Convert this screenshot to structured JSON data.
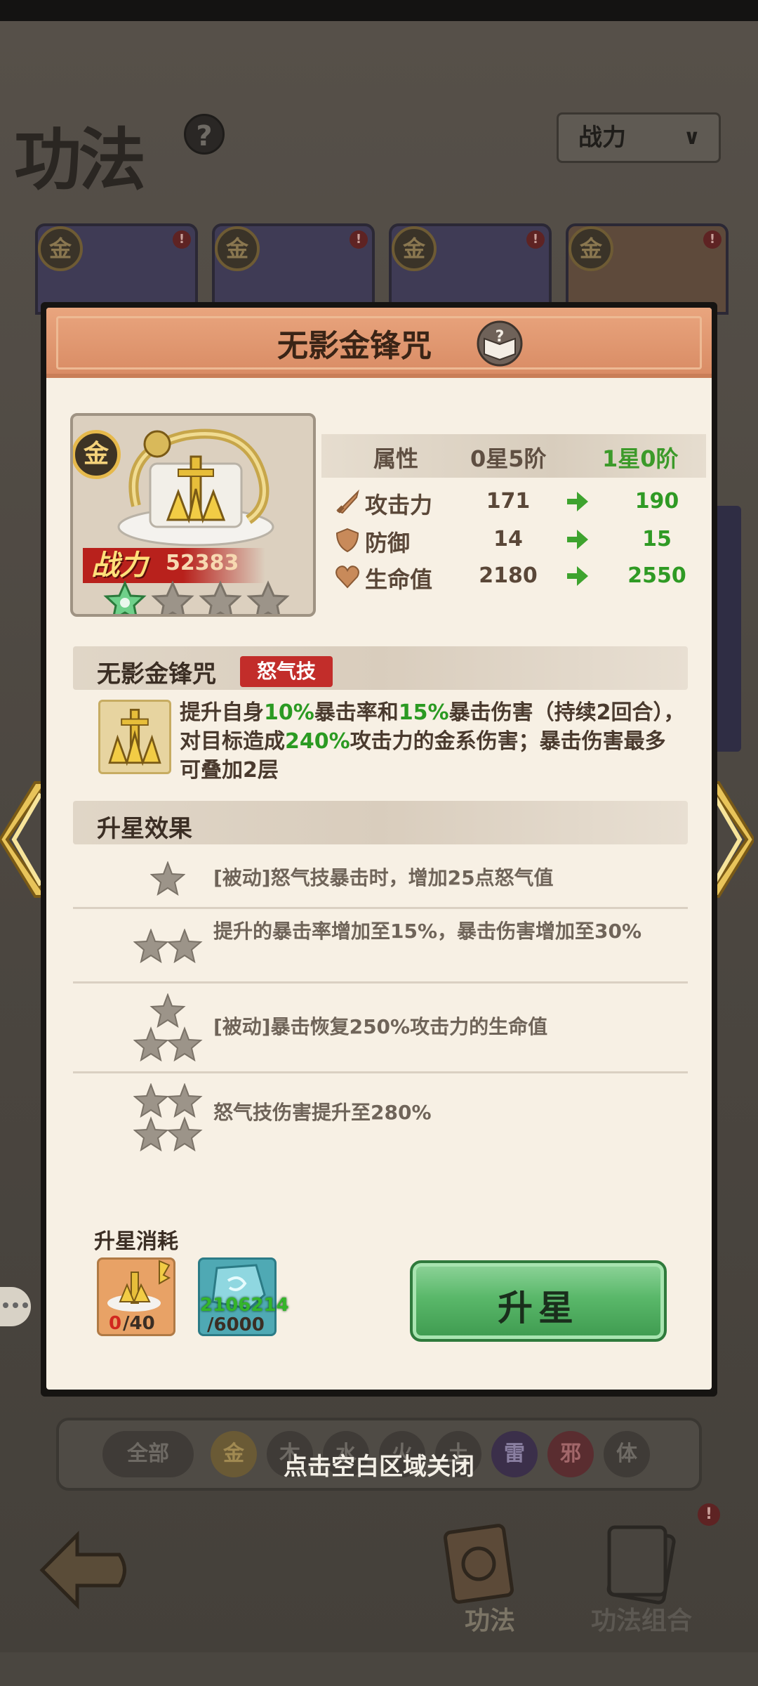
{
  "background": {
    "title": "功法",
    "help_symbol": "?",
    "sort_dropdown": {
      "selected": "战力"
    },
    "card_grade": "金",
    "card_alert": "!",
    "filters": [
      "全部",
      "金",
      "木",
      "水",
      "火",
      "土",
      "雷",
      "邪",
      "体"
    ],
    "bottom_tabs": [
      {
        "label": "功法",
        "active": true
      },
      {
        "label": "功法组合",
        "active": false
      }
    ],
    "tab_alert": "!"
  },
  "close_hint": "点击空白区域关闭",
  "modal": {
    "title": "无影金锋咒",
    "item": {
      "grade": "金",
      "power_label": "战力",
      "power_value": "52383",
      "stars_filled": 1,
      "stars_total": 4
    },
    "attributes": {
      "header": {
        "label": "属性",
        "current": "0星5阶",
        "next": "1星0阶"
      },
      "rows": [
        {
          "name": "攻击力",
          "icon": "sword-icon",
          "current": "171",
          "next": "190"
        },
        {
          "name": "防御",
          "icon": "shield-icon",
          "current": "14",
          "next": "15"
        },
        {
          "name": "生命值",
          "icon": "heart-icon",
          "current": "2180",
          "next": "2550"
        }
      ]
    },
    "skill": {
      "name": "无影金锋咒",
      "tag": "怒气技",
      "desc_parts": [
        {
          "text": "提升自身",
          "hl": false
        },
        {
          "text": "10%",
          "hl": true
        },
        {
          "text": "暴击率和",
          "hl": false
        },
        {
          "text": "15%",
          "hl": true
        },
        {
          "text": "暴击伤害（持续2回合），对目标造成",
          "hl": false
        },
        {
          "text": "240%",
          "hl": true
        },
        {
          "text": "攻击力的金系伤害；暴击伤害最多可叠加2层",
          "hl": false
        }
      ]
    },
    "star_effects": {
      "title": "升星效果",
      "rows": [
        {
          "stars": 1,
          "text": "[被动]怒气技暴击时，增加25点怒气值"
        },
        {
          "stars": 2,
          "text": "提升的暴击率增加至15%，暴击伤害增加至30%"
        },
        {
          "stars": 3,
          "text": "[被动]暴击恢复250%攻击力的生命值"
        },
        {
          "stars": 4,
          "text": "怒气技伤害提升至280%"
        }
      ]
    },
    "cost": {
      "title": "升星消耗",
      "items": [
        {
          "name": "skill-fragment",
          "have": "0",
          "need": "/40"
        },
        {
          "name": "rune-stone",
          "have": "2106214",
          "need": "/6000"
        }
      ]
    },
    "upgrade_button": "升星"
  }
}
